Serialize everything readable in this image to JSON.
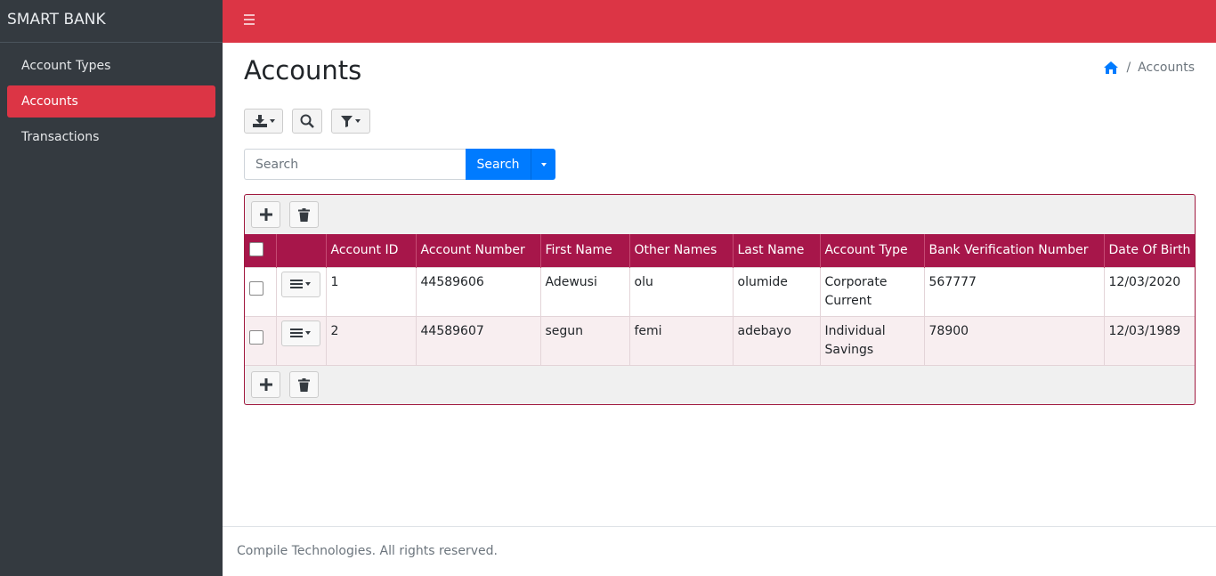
{
  "app": {
    "brand": "SMART BANK"
  },
  "sidebar": {
    "items": [
      {
        "label": "Account Types",
        "active": false
      },
      {
        "label": "Accounts",
        "active": true
      },
      {
        "label": "Transactions",
        "active": false
      }
    ]
  },
  "page": {
    "title": "Accounts"
  },
  "breadcrumb": {
    "current": "Accounts"
  },
  "search": {
    "placeholder": "Search",
    "button_label": "Search"
  },
  "table": {
    "columns": [
      "Account ID",
      "Account Number",
      "First Name",
      "Other Names",
      "Last Name",
      "Account Type",
      "Bank Verification Number",
      "Date Of Birth"
    ],
    "rows": [
      {
        "account_id": "1",
        "account_number": "44589606",
        "first_name": "Adewusi",
        "other_names": "olu",
        "last_name": "olumide",
        "account_type": "Corporate Current",
        "bvn": "567777",
        "dob": "12/03/2020"
      },
      {
        "account_id": "2",
        "account_number": "44589607",
        "first_name": "segun",
        "other_names": "femi",
        "last_name": "adebayo",
        "account_type": "Individual Savings",
        "bvn": "78900",
        "dob": "12/03/1989"
      }
    ]
  },
  "footer": {
    "text": "Compile Technologies. All rights reserved."
  },
  "colors": {
    "accent": "#dc3545",
    "table_header": "#a7164a",
    "primary": "#007bff",
    "sidebar": "#343a40"
  }
}
